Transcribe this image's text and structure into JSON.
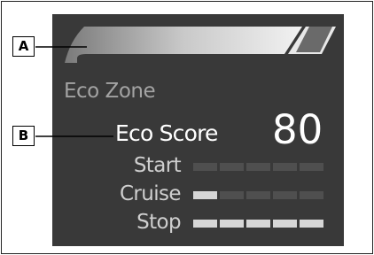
{
  "callouts": {
    "a": "A",
    "b": "B"
  },
  "eco_zone": {
    "label": "Eco Zone"
  },
  "eco_score": {
    "label": "Eco Score",
    "value": "80"
  },
  "metrics": [
    {
      "label": "Start",
      "level": 0,
      "max": 5
    },
    {
      "label": "Cruise",
      "level": 1,
      "max": 5
    },
    {
      "label": "Stop",
      "level": 5,
      "max": 5
    }
  ],
  "colors": {
    "screen_bg": "#393939",
    "segment_on": "#d6d6d6",
    "segment_off": "#4f4f4f"
  }
}
